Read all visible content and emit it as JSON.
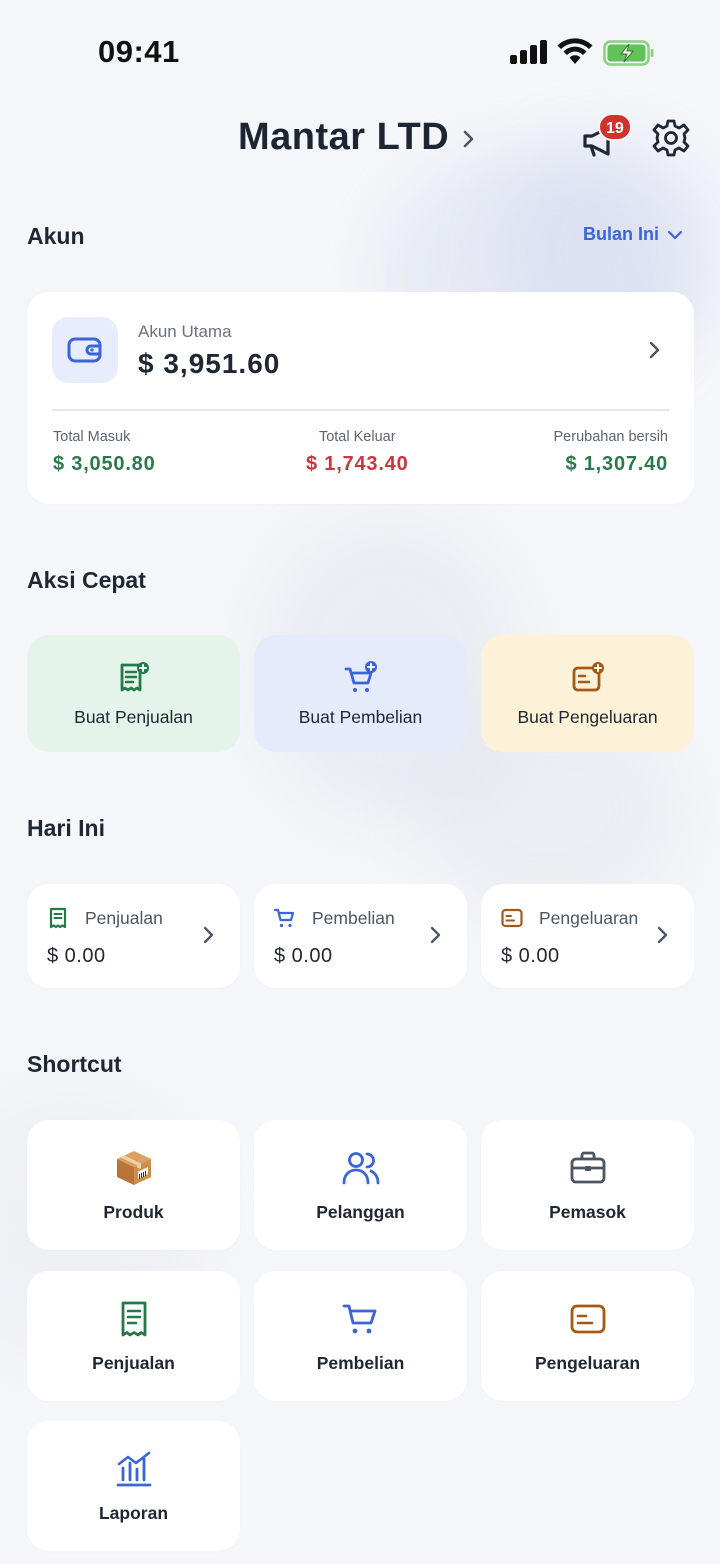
{
  "status_bar": {
    "time": "09:41"
  },
  "header": {
    "company": "Mantar LTD",
    "notification_count": "19"
  },
  "account_section": {
    "title": "Akun",
    "period": "Bulan Ini",
    "account_name": "Akun Utama",
    "balance": "$ 3,951.60",
    "stats": [
      {
        "label": "Total Masuk",
        "value": "$ 3,050.80"
      },
      {
        "label": "Total Keluar",
        "value": "$ 1,743.40"
      },
      {
        "label": "Perubahan bersih",
        "value": "$ 1,307.40"
      }
    ]
  },
  "quick_actions": {
    "title": "Aksi Cepat",
    "items": [
      {
        "label": "Buat Penjualan",
        "icon": "receipt-plus-icon",
        "bg": "#e4f4ea",
        "color": "#237a48"
      },
      {
        "label": "Buat Pembelian",
        "icon": "cart-plus-icon",
        "bg": "#e6ebfc",
        "color": "#3b64d6"
      },
      {
        "label": "Buat Pengeluaran",
        "icon": "wallet-plus-icon",
        "bg": "#fdf2d7",
        "color": "#a35a17"
      }
    ]
  },
  "today": {
    "title": "Hari Ini",
    "items": [
      {
        "label": "Penjualan",
        "value": "$ 0.00",
        "icon": "receipt-icon"
      },
      {
        "label": "Pembelian",
        "value": "$ 0.00",
        "icon": "cart-icon"
      },
      {
        "label": "Pengeluaran",
        "value": "$ 0.00",
        "icon": "wallet-icon"
      }
    ]
  },
  "shortcuts": {
    "title": "Shortcut",
    "items": [
      {
        "label": "Produk",
        "icon": "package-icon"
      },
      {
        "label": "Pelanggan",
        "icon": "users-icon"
      },
      {
        "label": "Pemasok",
        "icon": "briefcase-icon"
      },
      {
        "label": "Penjualan",
        "icon": "receipt-icon"
      },
      {
        "label": "Pembelian",
        "icon": "cart-icon"
      },
      {
        "label": "Pengeluaran",
        "icon": "wallet-icon"
      },
      {
        "label": "Laporan",
        "icon": "chart-icon"
      }
    ]
  },
  "colors": {
    "accent": "#3b64d6",
    "positive": "#2a7a4b",
    "negative": "#c9363b",
    "badge": "#d3322c"
  }
}
